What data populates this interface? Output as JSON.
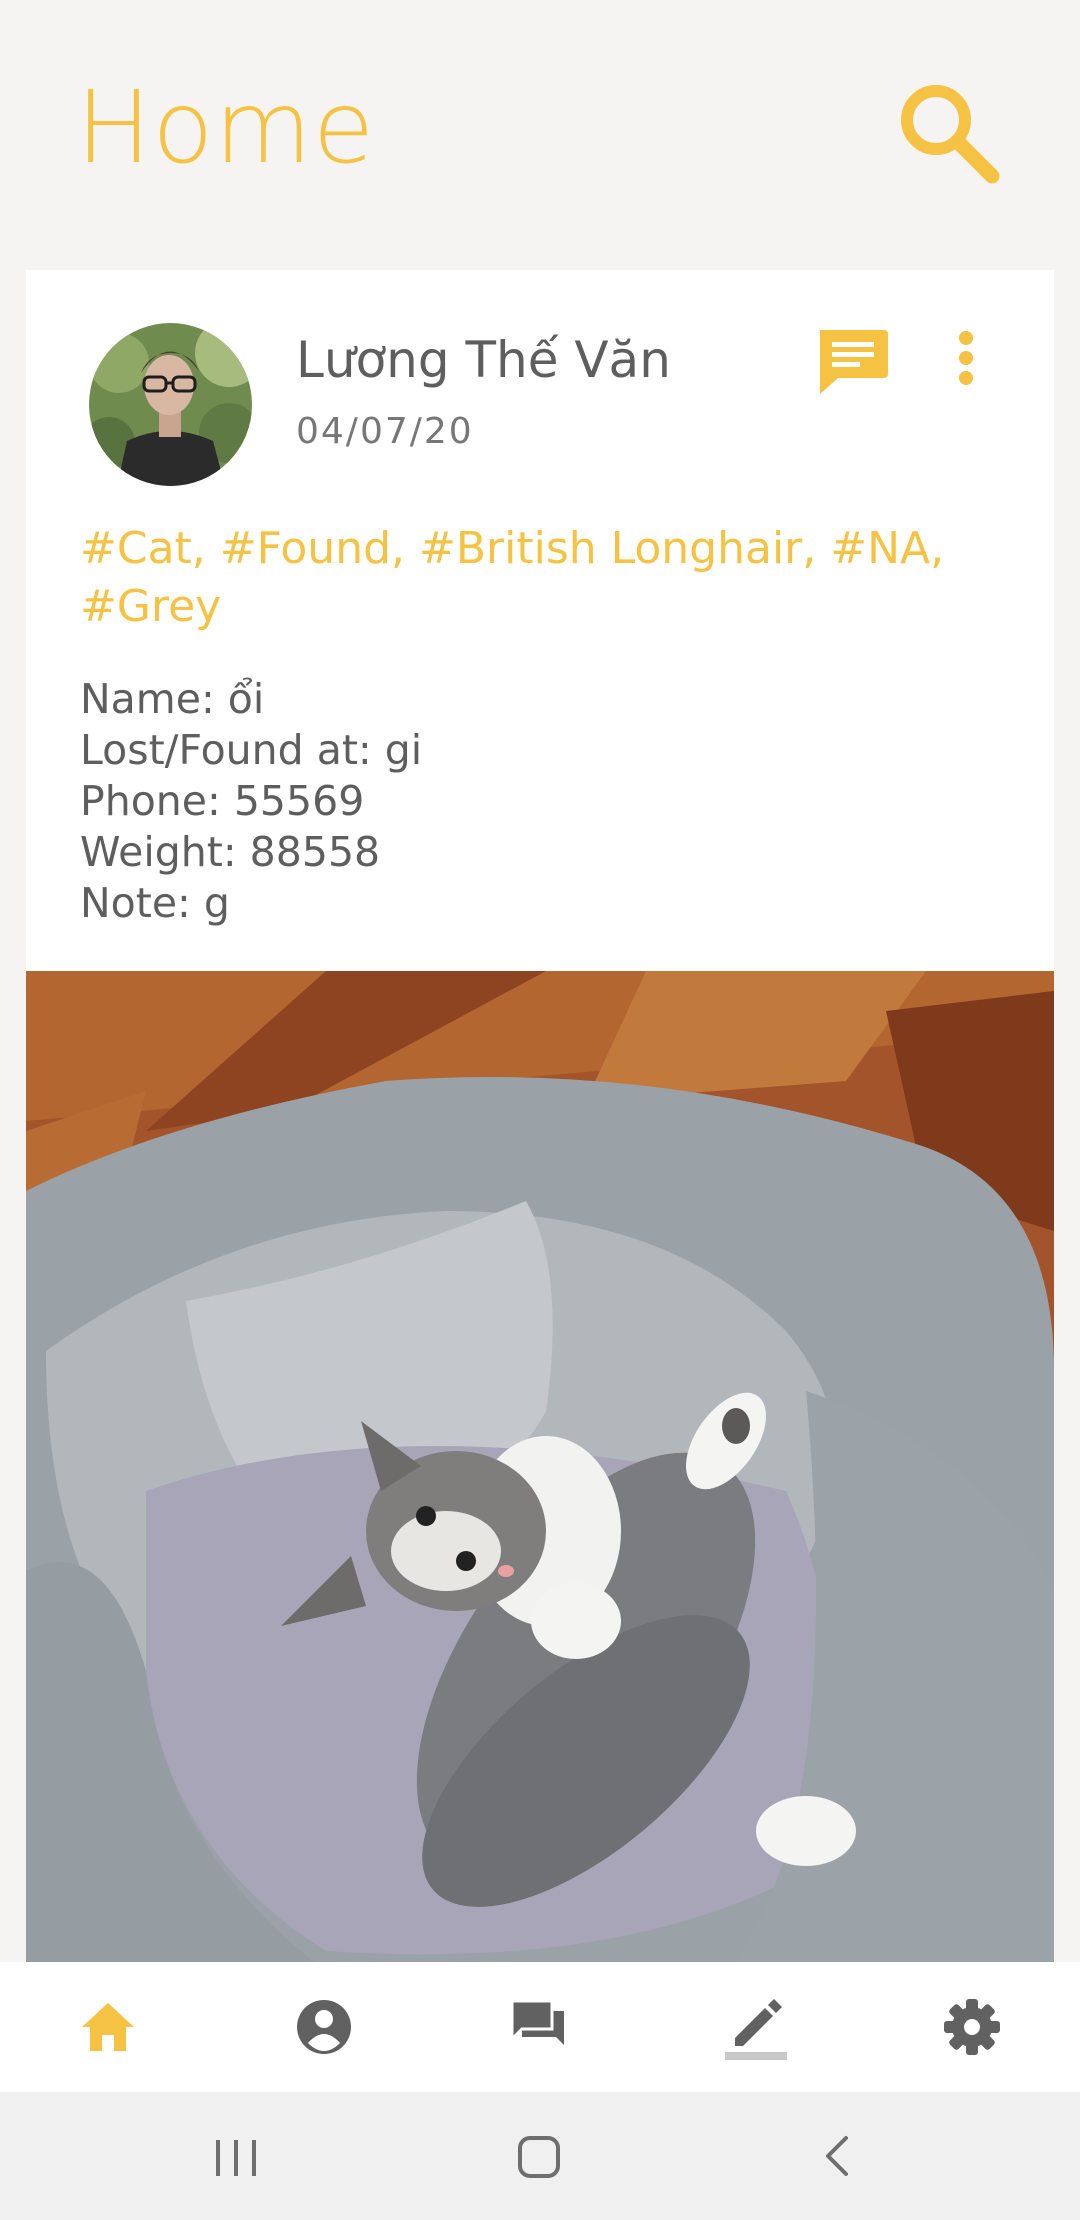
{
  "header": {
    "title": "Home"
  },
  "post": {
    "author": "Lương Thế Văn",
    "date": "04/07/20",
    "tags": "#Cat, #Found, #British Longhair, #NA, #Grey",
    "details": [
      "Name: ổi",
      "Lost/Found at: gi",
      "Phone: 55569",
      "Weight: 88558",
      "Note: g"
    ]
  },
  "icons": {
    "search": "search-icon",
    "comment": "comment-icon",
    "more": "more-vert-icon",
    "nav": [
      "home-icon",
      "account-icon",
      "forum-icon",
      "edit-icon",
      "settings-icon"
    ]
  },
  "colors": {
    "accent": "#f6c244",
    "text": "#5e5e5e",
    "icon_gray": "#616161",
    "background": "#f5f4f2"
  }
}
